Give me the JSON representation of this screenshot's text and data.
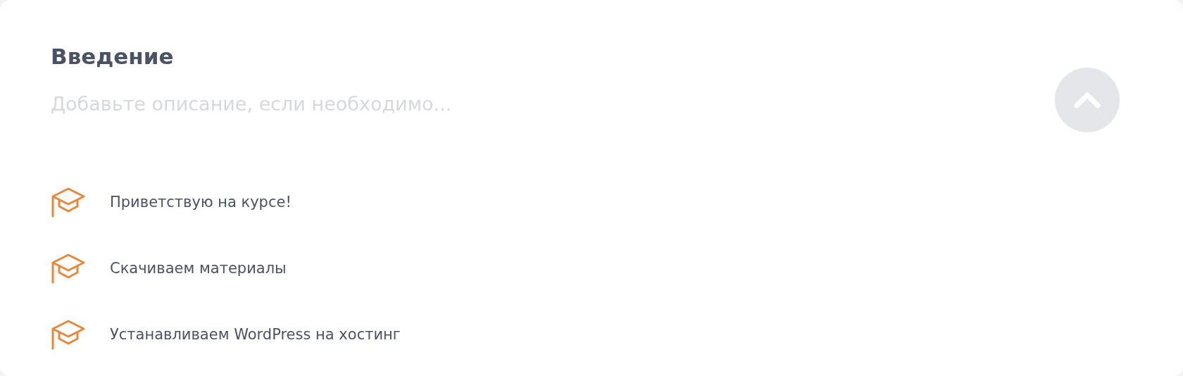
{
  "section": {
    "title": "Введение",
    "description": {
      "placeholder": "Добавьте описание, если необходимо..."
    },
    "collapse_button": {
      "expanded": true
    },
    "lessons": [
      {
        "title": "Приветствую на курсе!"
      },
      {
        "title": "Скачиваем материалы"
      },
      {
        "title": "Устанавливаем WordPress на хостинг"
      }
    ]
  }
}
